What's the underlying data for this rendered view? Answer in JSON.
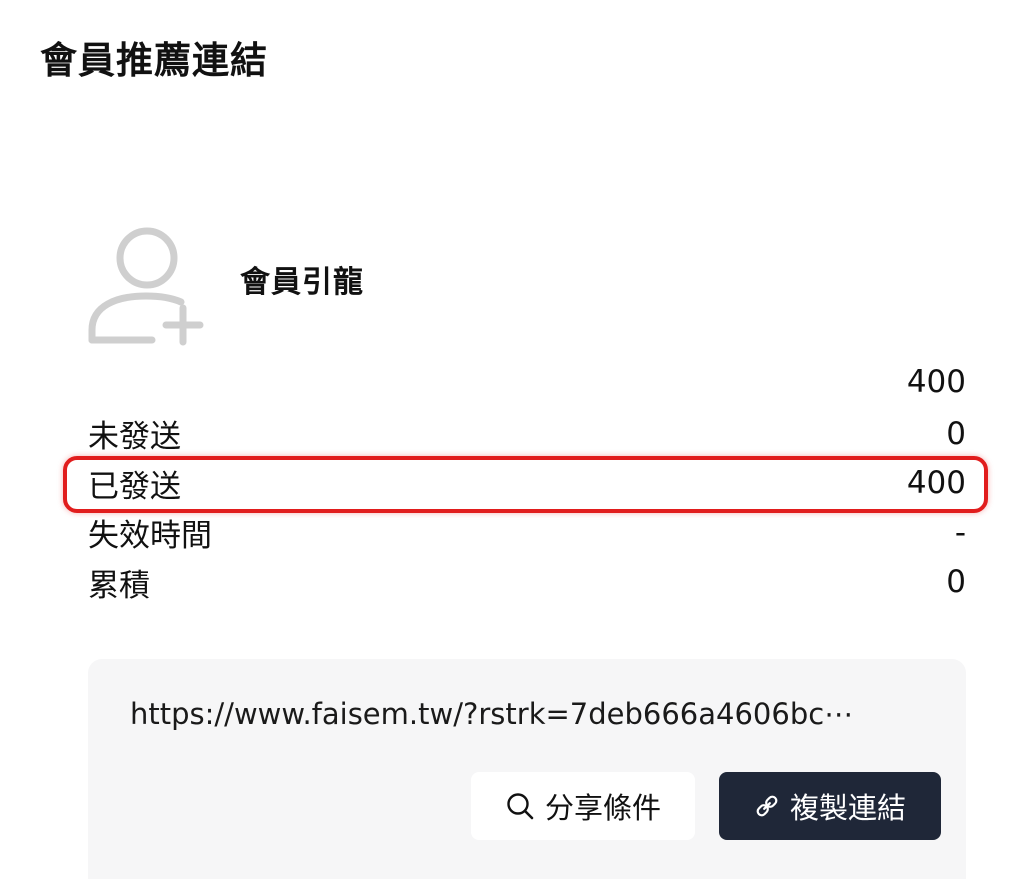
{
  "page": {
    "title": "會員推薦連結"
  },
  "referral": {
    "icon": "add-user-icon",
    "title": "會員引龍",
    "total": "400",
    "stats": [
      {
        "label": "未發送",
        "value": "0"
      },
      {
        "label": "已發送",
        "value": "400",
        "highlighted": true
      },
      {
        "label": "失效時間",
        "value": "-"
      },
      {
        "label": "累積",
        "value": "0"
      }
    ]
  },
  "link": {
    "url": "https://www.faisem.tw/?rstrk=7deb666a4606bc⋯",
    "share_label": "分享條件",
    "share_icon": "search-icon",
    "copy_label": "複製連結",
    "copy_icon": "link-icon"
  },
  "colors": {
    "highlight": "#e11d1d",
    "copy_button": "#1f2738",
    "panel_background": "#f6f6f7",
    "icon_gray": "#cfcfcf"
  }
}
